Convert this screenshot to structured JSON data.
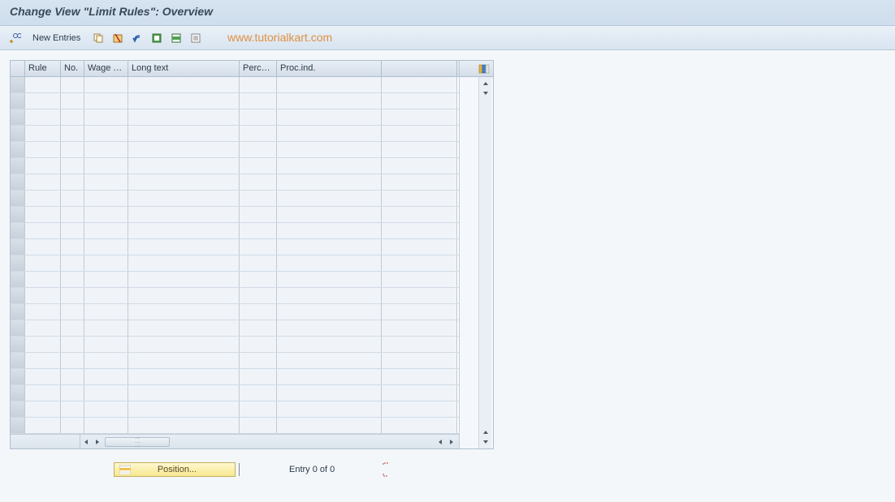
{
  "title": "Change View \"Limit Rules\": Overview",
  "toolbar": {
    "new_entries_label": "New Entries"
  },
  "watermark": "www.tutorialkart.com",
  "table": {
    "columns": [
      "Rule",
      "No.",
      "Wage T...",
      "Long text",
      "Perce...",
      "Proc.ind."
    ],
    "row_count": 22
  },
  "bottom": {
    "position_label": "Position...",
    "entry_text": "Entry 0 of 0"
  }
}
